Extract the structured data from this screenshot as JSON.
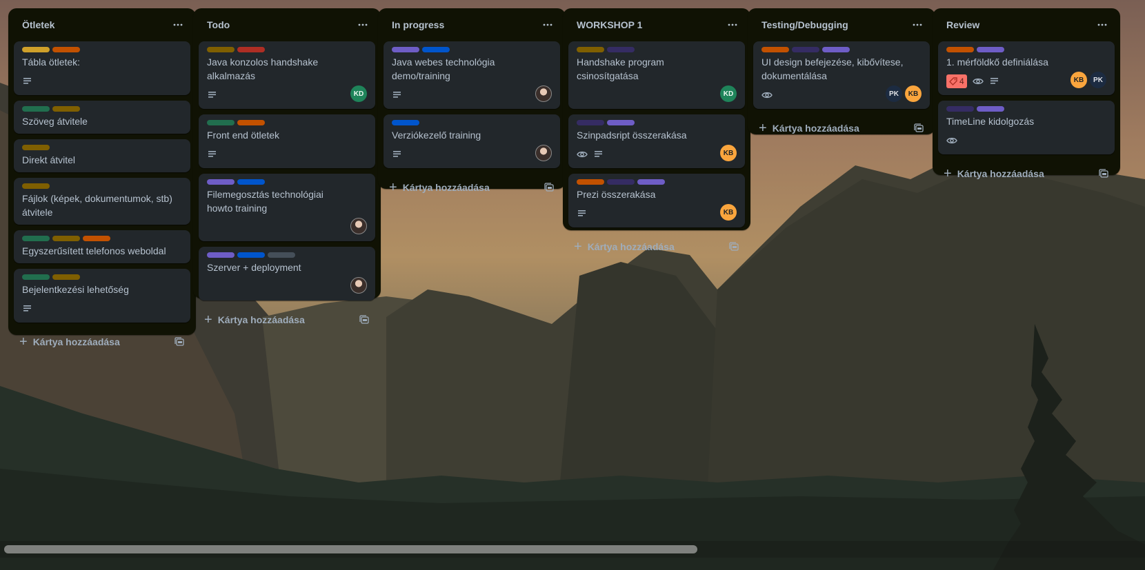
{
  "colors": {
    "yellow": "#cfa02a",
    "orange": "#c25100",
    "green": "#216e4e",
    "olive": "#7f5f01",
    "red": "#ae2e24",
    "purple": "#6e5dc6",
    "blue": "#0055cc",
    "gray": "#454f59",
    "darkpurple": "#352c63",
    "kd": "#1f845a",
    "kb": "#faa53d",
    "pk": "#1c2b41"
  },
  "lists": [
    {
      "title": "Ötletek",
      "menu": "···",
      "add_label": "Kártya hozzáadása",
      "cards": [
        {
          "labels": [
            "yellow",
            "orange"
          ],
          "title": "Tábla ötletek:",
          "badges": [
            "description"
          ],
          "members": []
        },
        {
          "labels": [
            "green",
            "olive"
          ],
          "title": "Szöveg átvitele",
          "badges": [],
          "members": []
        },
        {
          "labels": [
            "olive"
          ],
          "title": "Direkt átvitel",
          "badges": [],
          "members": []
        },
        {
          "labels": [
            "olive"
          ],
          "title": "Fájlok (képek, dokumentumok, stb) átvitele",
          "badges": [],
          "members": []
        },
        {
          "labels": [
            "green",
            "olive",
            "orange"
          ],
          "title": "Egyszerűsített telefonos weboldal",
          "badges": [],
          "members": []
        },
        {
          "labels": [
            "green",
            "olive"
          ],
          "title": "Bejelentkezési lehetőség",
          "badges": [
            "description"
          ],
          "members": []
        }
      ]
    },
    {
      "title": "Todo",
      "menu": "···",
      "add_label": "Kártya hozzáadása",
      "cards": [
        {
          "labels": [
            "olive",
            "red"
          ],
          "title": "Java konzolos handshake alkalmazás",
          "badges": [
            "description"
          ],
          "members": [
            "KD"
          ]
        },
        {
          "labels": [
            "green",
            "orange"
          ],
          "title": "Front end ötletek",
          "badges": [
            "description"
          ],
          "members": []
        },
        {
          "labels": [
            "purple",
            "blue"
          ],
          "title": "Filemegosztás technológiai howto training",
          "badges": [],
          "members": [
            "photo"
          ]
        },
        {
          "labels": [
            "purple",
            "blue",
            "gray"
          ],
          "title": "Szerver + deployment",
          "badges": [],
          "members": [
            "photo"
          ]
        }
      ]
    },
    {
      "title": "In progress",
      "menu": "···",
      "add_label": "Kártya hozzáadása",
      "cards": [
        {
          "labels": [
            "purple",
            "blue"
          ],
          "title": "Java webes technológia demo/training",
          "badges": [
            "description"
          ],
          "members": [
            "photo"
          ]
        },
        {
          "labels": [
            "blue"
          ],
          "title": "Verziókezelő training",
          "badges": [
            "description"
          ],
          "members": [
            "photo"
          ]
        }
      ]
    },
    {
      "title": "WORKSHOP 1",
      "menu": "···",
      "add_label": "Kártya hozzáadása",
      "cards": [
        {
          "labels": [
            "olive",
            "darkpurple"
          ],
          "title": "Handshake program csinosítgatása",
          "badges": [],
          "members": [
            "KD"
          ]
        },
        {
          "labels": [
            "darkpurple",
            "purple"
          ],
          "title": "Szinpadsript összerakása",
          "badges": [
            "watch",
            "description"
          ],
          "members": [
            "KB"
          ]
        },
        {
          "labels": [
            "orange",
            "darkpurple",
            "purple"
          ],
          "title": "Prezi összerakása",
          "badges": [
            "description"
          ],
          "members": [
            "KB"
          ]
        }
      ]
    },
    {
      "title": "Testing/Debugging",
      "menu": "···",
      "add_label": "Kártya hozzáadása",
      "cards": [
        {
          "labels": [
            "orange",
            "darkpurple",
            "purple"
          ],
          "title": "UI design befejezése, kibővítese, dokumentálása",
          "badges": [
            "watch"
          ],
          "members": [
            "PK",
            "KB"
          ]
        }
      ]
    },
    {
      "title": "Review",
      "menu": "···",
      "add_label": "Kártya hozzáadása",
      "cards": [
        {
          "labels": [
            "orange",
            "purple"
          ],
          "title": "1. mérföldkő definiálása",
          "badges": [
            "count",
            "watch",
            "description"
          ],
          "count": "4",
          "members": [
            "KB",
            "PK"
          ]
        },
        {
          "labels": [
            "darkpurple",
            "purple"
          ],
          "title": "TimeLine kidolgozás",
          "badges": [
            "watch"
          ],
          "members": []
        }
      ]
    }
  ]
}
